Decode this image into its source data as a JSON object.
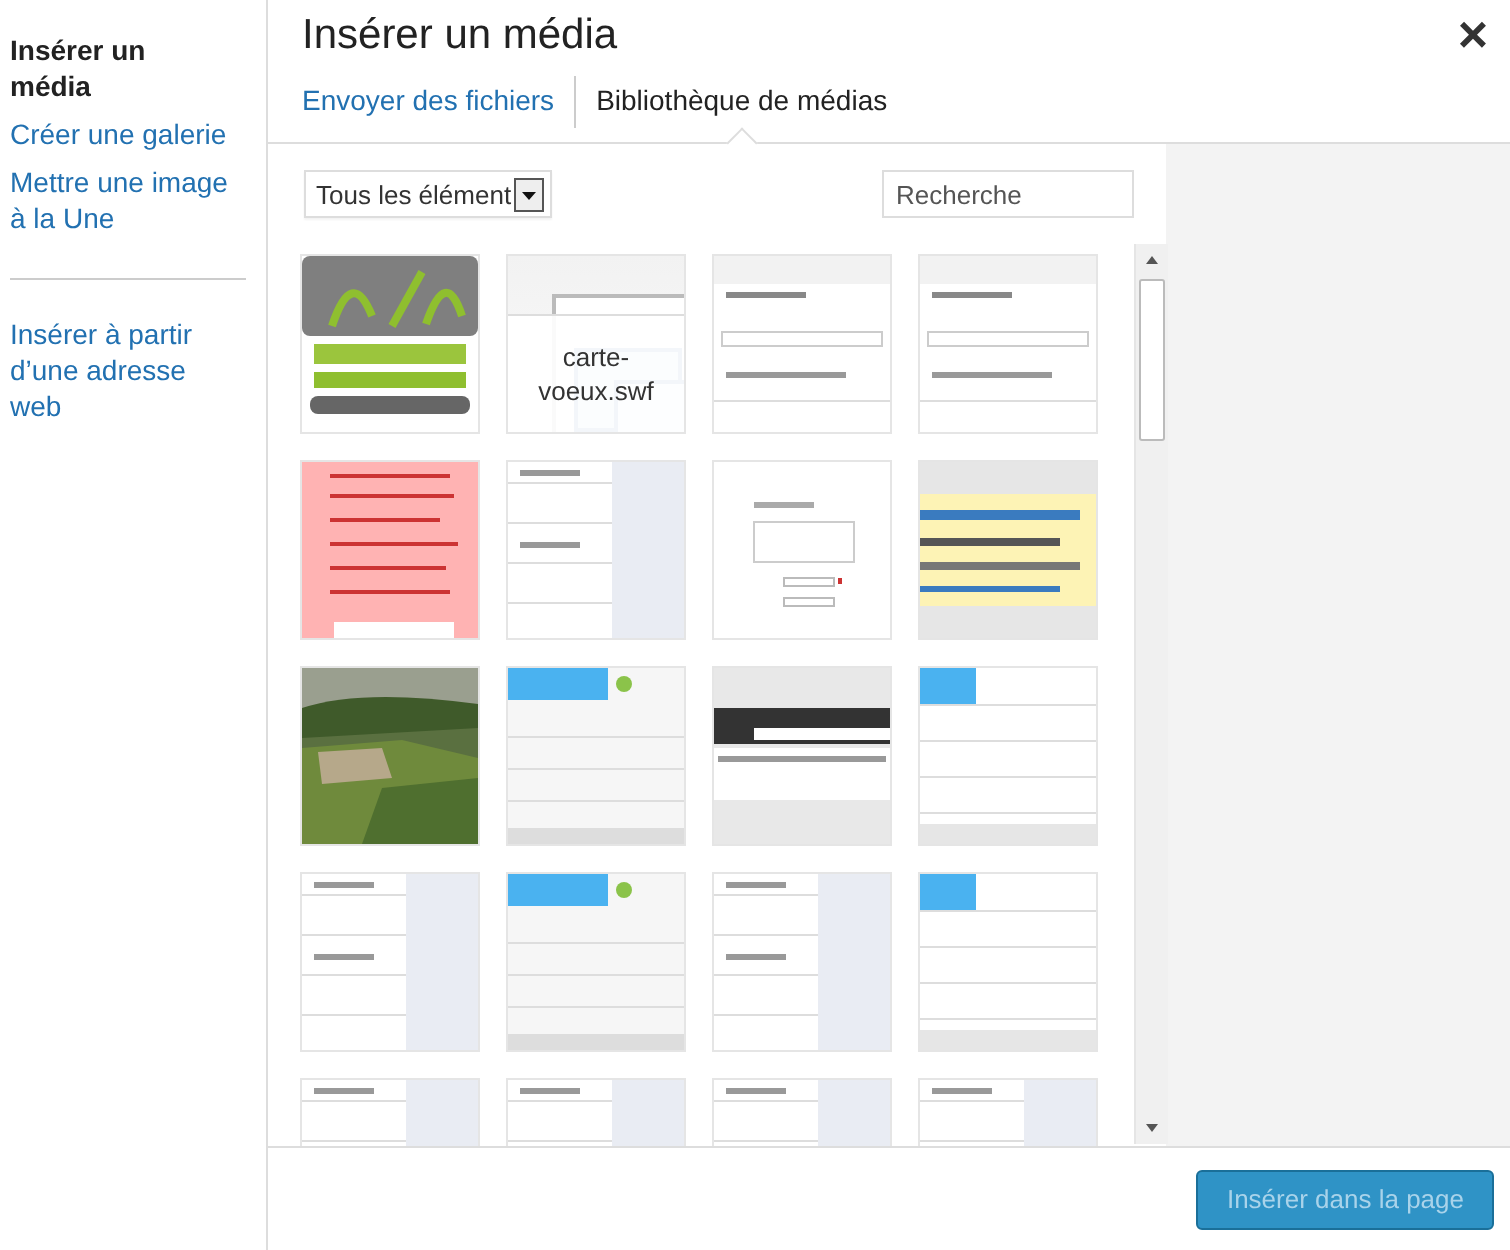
{
  "sidebar": {
    "groups": [
      [
        {
          "label": "Insérer un média",
          "selected": true
        },
        {
          "label": "Créer une galerie",
          "selected": false
        },
        {
          "label": "Mettre une image à la Une",
          "selected": false
        }
      ],
      [
        {
          "label": "Insérer à partir d’une adresse web",
          "selected": false
        }
      ]
    ]
  },
  "title": "Insérer un média",
  "close": "×",
  "tabs": [
    {
      "label": "Envoyer des fichiers",
      "selected": false
    },
    {
      "label": "Bibliothèque de médias",
      "selected": true
    }
  ],
  "filter": {
    "value": "Tous les élément"
  },
  "search": {
    "placeholder": "Recherche"
  },
  "attachments": [
    {
      "kind": "picture"
    },
    {
      "kind": "file",
      "filename": "carte-voeux.swf"
    },
    {
      "kind": "picture"
    },
    {
      "kind": "picture"
    },
    {
      "kind": "picture"
    },
    {
      "kind": "picture"
    },
    {
      "kind": "picture"
    },
    {
      "kind": "picture"
    },
    {
      "kind": "picture"
    },
    {
      "kind": "picture"
    },
    {
      "kind": "picture"
    },
    {
      "kind": "picture"
    },
    {
      "kind": "picture"
    },
    {
      "kind": "picture"
    },
    {
      "kind": "picture"
    },
    {
      "kind": "picture"
    },
    {
      "kind": "picture"
    },
    {
      "kind": "picture"
    },
    {
      "kind": "picture"
    },
    {
      "kind": "picture"
    }
  ],
  "insert_button": {
    "label": "Insérer dans la page",
    "disabled": true
  }
}
